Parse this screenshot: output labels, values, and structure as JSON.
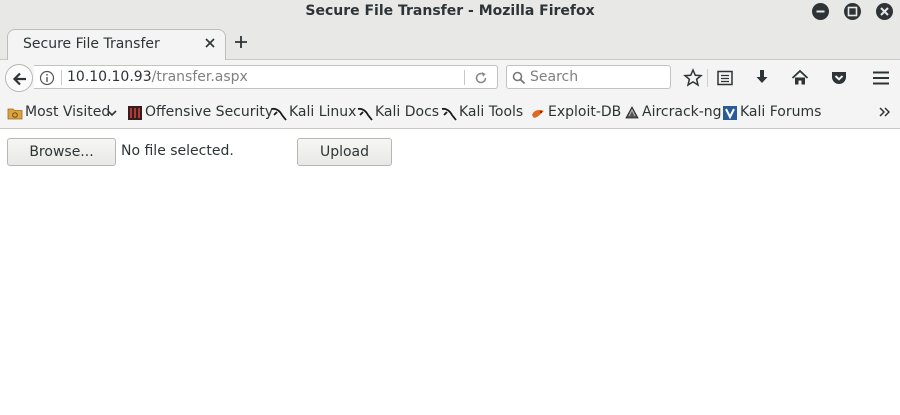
{
  "window": {
    "title": "Secure File Transfer - Mozilla Firefox"
  },
  "tab": {
    "label": "Secure File Transfer"
  },
  "navigation": {
    "url_host": "10.10.10.93",
    "url_path": "/transfer.aspx",
    "search_placeholder": "Search"
  },
  "bookmarks": [
    {
      "label": "Most Visited",
      "icon": "folder-icon"
    },
    {
      "label": "Offensive Security",
      "icon": "offsec-icon"
    },
    {
      "label": "Kali Linux",
      "icon": "kali-dragon-icon"
    },
    {
      "label": "Kali Docs",
      "icon": "kali-dragon-icon"
    },
    {
      "label": "Kali Tools",
      "icon": "kali-dragon-icon"
    },
    {
      "label": "Exploit-DB",
      "icon": "exploitdb-icon"
    },
    {
      "label": "Aircrack-ng",
      "icon": "aircrack-icon"
    },
    {
      "label": "Kali Forums",
      "icon": "kali-forums-icon"
    }
  ],
  "page": {
    "browse_label": "Browse...",
    "file_status": "No file selected.",
    "upload_label": "Upload"
  }
}
